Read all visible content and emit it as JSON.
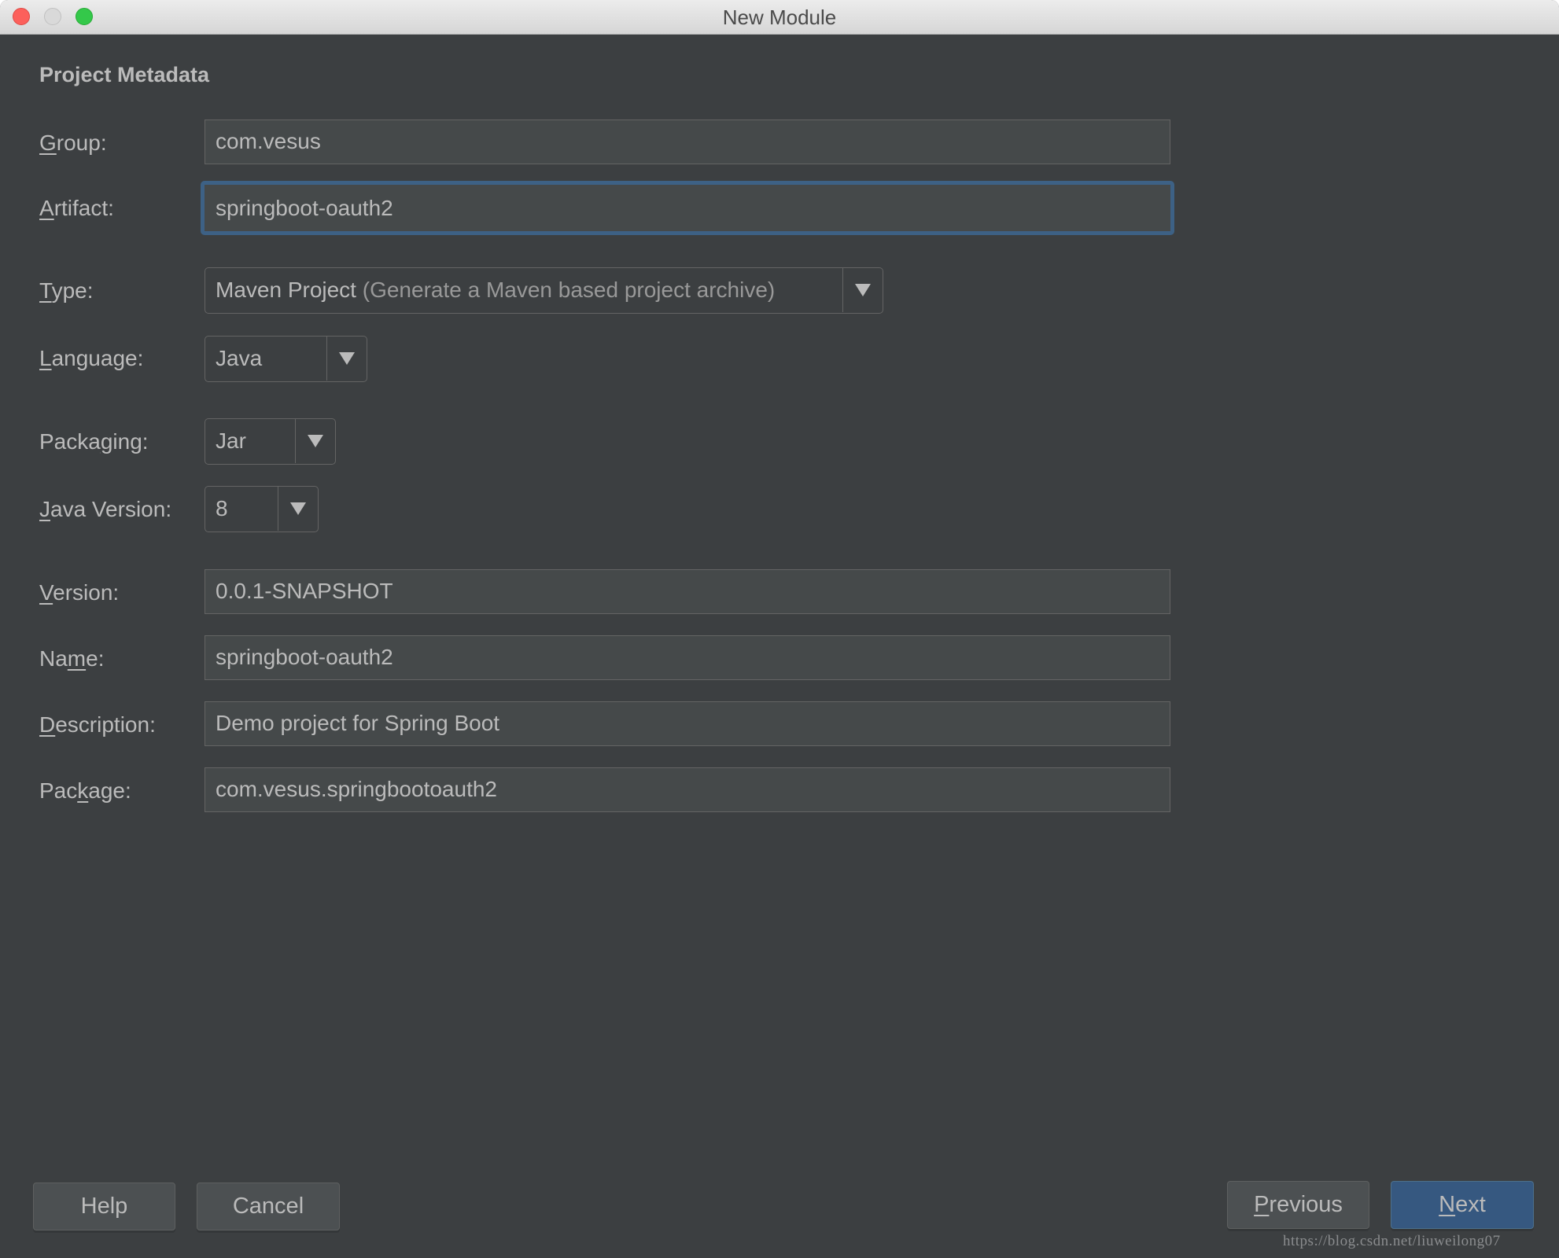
{
  "window": {
    "title": "New Module",
    "traffic_lights": [
      "close",
      "minimize",
      "maximize"
    ]
  },
  "form": {
    "section_title": "Project Metadata",
    "group": {
      "label_mnemonic": "G",
      "label_rest": "roup:",
      "value": "com.vesus"
    },
    "artifact": {
      "label_mnemonic": "A",
      "label_rest": "rtifact:",
      "value": "springboot-oauth2",
      "focused": true
    },
    "type": {
      "label_mnemonic": "T",
      "label_rest": "ype:",
      "value": "Maven Project",
      "hint": "(Generate a Maven based project archive)"
    },
    "language": {
      "label_mnemonic": "L",
      "label_rest": "anguage:",
      "value": "Java"
    },
    "packaging": {
      "label_pre": "Packa",
      "label_mnemonic": "g",
      "label_rest": "ing:",
      "value": "Jar"
    },
    "java_version": {
      "label_mnemonic": "J",
      "label_rest": "ava Version:",
      "value": "8"
    },
    "version": {
      "label_mnemonic": "V",
      "label_rest": "ersion:",
      "value": "0.0.1-SNAPSHOT"
    },
    "name": {
      "label_pre": "Na",
      "label_mnemonic": "m",
      "label_rest": "e:",
      "value": "springboot-oauth2"
    },
    "description": {
      "label_mnemonic": "D",
      "label_rest": "escription:",
      "value": "Demo project for Spring Boot"
    },
    "package": {
      "label_pre": "Pac",
      "label_mnemonic": "k",
      "label_rest": "age:",
      "value": "com.vesus.springbootoauth2"
    }
  },
  "buttons": {
    "help": "Help",
    "cancel": "Cancel",
    "previous_mnemonic": "P",
    "previous_rest": "revious",
    "next_mnemonic": "N",
    "next_rest": "ext"
  },
  "watermark": "https://blog.csdn.net/liuweilong07",
  "colors": {
    "background": "#3c3f41",
    "field_background": "#45494a",
    "focus_border": "#3d6185",
    "primary_button": "#365880",
    "text": "#bbbbbb"
  }
}
